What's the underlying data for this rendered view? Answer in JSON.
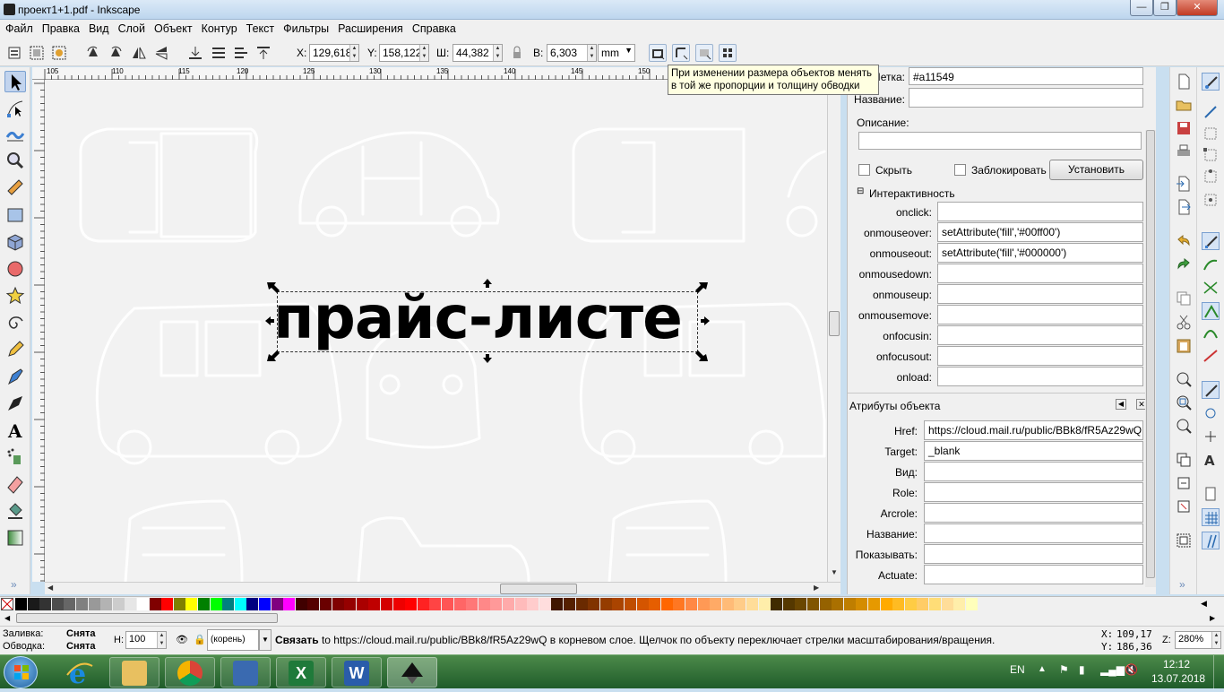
{
  "window": {
    "title": "проект1+1.pdf - Inkscape"
  },
  "menu": [
    "Файл",
    "Правка",
    "Вид",
    "Слой",
    "Объект",
    "Контур",
    "Текст",
    "Фильтры",
    "Расширения",
    "Справка"
  ],
  "toolbar": {
    "x_label": "X:",
    "x_value": "129,618",
    "y_label": "Y:",
    "y_value": "158,122",
    "w_label": "Ш:",
    "w_value": "44,382",
    "h_label": "В:",
    "h_value": "6,303",
    "unit": "mm"
  },
  "tooltip": {
    "line1": "При изменении размера объектов менять",
    "line2": "в той же пропорции и толщину обводки"
  },
  "canvas": {
    "text": "прайс-листе"
  },
  "ruler": {
    "ticks": [
      "105",
      "110",
      "115",
      "120",
      "125",
      "130",
      "135",
      "140",
      "145",
      "150",
      "155"
    ]
  },
  "object_props": {
    "id_label": "Метка:",
    "id_value": "#a11549",
    "name_label": "Название:",
    "name_value": "",
    "desc_label": "Описание:",
    "hide_label": "Скрыть",
    "lock_label": "Заблокировать",
    "set_button": "Установить",
    "interactivity_label": "Интерактивность",
    "events": [
      {
        "label": "onclick:",
        "value": ""
      },
      {
        "label": "onmouseover:",
        "value": "setAttribute('fill','#00ff00')"
      },
      {
        "label": "onmouseout:",
        "value": "setAttribute('fill','#000000')"
      },
      {
        "label": "onmousedown:",
        "value": ""
      },
      {
        "label": "onmouseup:",
        "value": ""
      },
      {
        "label": "onmousemove:",
        "value": ""
      },
      {
        "label": "onfocusin:",
        "value": ""
      },
      {
        "label": "onfocusout:",
        "value": ""
      },
      {
        "label": "onload:",
        "value": ""
      }
    ]
  },
  "object_attrs": {
    "title": "Атрибуты объекта",
    "rows": [
      {
        "label": "Href:",
        "value": "https://cloud.mail.ru/public/BBk8/fR5Az29wQ"
      },
      {
        "label": "Target:",
        "value": "_blank"
      },
      {
        "label": "Вид:",
        "value": ""
      },
      {
        "label": "Role:",
        "value": ""
      },
      {
        "label": "Arcrole:",
        "value": ""
      },
      {
        "label": "Название:",
        "value": ""
      },
      {
        "label": "Показывать:",
        "value": ""
      },
      {
        "label": "Actuate:",
        "value": ""
      }
    ]
  },
  "status": {
    "fill_label": "Заливка:",
    "fill_value": "Снята",
    "stroke_label": "Обводка:",
    "stroke_value": "Снята",
    "h_label": "Н:",
    "h_value": "100",
    "layer": "(корень)",
    "message_bold": "Связать",
    "message": " to https://cloud.mail.ru/public/BBk8/fR5Az29wQ в корневом слое. Щелчок по объекту переключает стрелки масштабирования/вращения.",
    "cx_label": "X:",
    "cx_value": "109,17",
    "cy_label": "Y:",
    "cy_value": "186,36",
    "zoom_label": "Z:",
    "zoom_value": "280%"
  },
  "taskbar": {
    "lang": "EN",
    "time": "12:12",
    "date": "13.07.2018"
  },
  "colors": {
    "accent": "#3c7fd1",
    "taskbar": "#2d6e34"
  }
}
